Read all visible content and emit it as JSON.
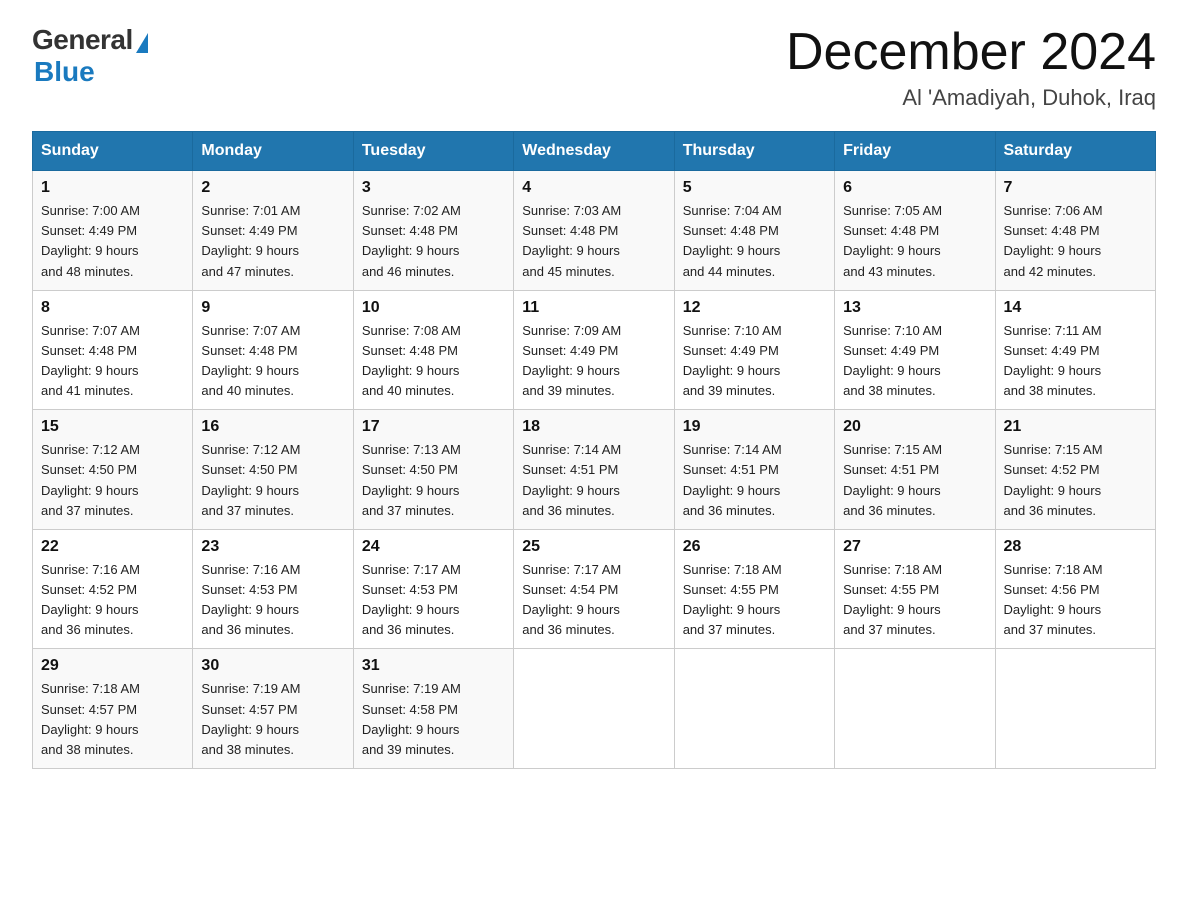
{
  "header": {
    "logo_general": "General",
    "logo_blue": "Blue",
    "month_title": "December 2024",
    "location": "Al 'Amadiyah, Duhok, Iraq"
  },
  "weekdays": [
    "Sunday",
    "Monday",
    "Tuesday",
    "Wednesday",
    "Thursday",
    "Friday",
    "Saturday"
  ],
  "weeks": [
    [
      {
        "day": "1",
        "sunrise": "7:00 AM",
        "sunset": "4:49 PM",
        "daylight": "9 hours and 48 minutes."
      },
      {
        "day": "2",
        "sunrise": "7:01 AM",
        "sunset": "4:49 PM",
        "daylight": "9 hours and 47 minutes."
      },
      {
        "day": "3",
        "sunrise": "7:02 AM",
        "sunset": "4:48 PM",
        "daylight": "9 hours and 46 minutes."
      },
      {
        "day": "4",
        "sunrise": "7:03 AM",
        "sunset": "4:48 PM",
        "daylight": "9 hours and 45 minutes."
      },
      {
        "day": "5",
        "sunrise": "7:04 AM",
        "sunset": "4:48 PM",
        "daylight": "9 hours and 44 minutes."
      },
      {
        "day": "6",
        "sunrise": "7:05 AM",
        "sunset": "4:48 PM",
        "daylight": "9 hours and 43 minutes."
      },
      {
        "day": "7",
        "sunrise": "7:06 AM",
        "sunset": "4:48 PM",
        "daylight": "9 hours and 42 minutes."
      }
    ],
    [
      {
        "day": "8",
        "sunrise": "7:07 AM",
        "sunset": "4:48 PM",
        "daylight": "9 hours and 41 minutes."
      },
      {
        "day": "9",
        "sunrise": "7:07 AM",
        "sunset": "4:48 PM",
        "daylight": "9 hours and 40 minutes."
      },
      {
        "day": "10",
        "sunrise": "7:08 AM",
        "sunset": "4:48 PM",
        "daylight": "9 hours and 40 minutes."
      },
      {
        "day": "11",
        "sunrise": "7:09 AM",
        "sunset": "4:49 PM",
        "daylight": "9 hours and 39 minutes."
      },
      {
        "day": "12",
        "sunrise": "7:10 AM",
        "sunset": "4:49 PM",
        "daylight": "9 hours and 39 minutes."
      },
      {
        "day": "13",
        "sunrise": "7:10 AM",
        "sunset": "4:49 PM",
        "daylight": "9 hours and 38 minutes."
      },
      {
        "day": "14",
        "sunrise": "7:11 AM",
        "sunset": "4:49 PM",
        "daylight": "9 hours and 38 minutes."
      }
    ],
    [
      {
        "day": "15",
        "sunrise": "7:12 AM",
        "sunset": "4:50 PM",
        "daylight": "9 hours and 37 minutes."
      },
      {
        "day": "16",
        "sunrise": "7:12 AM",
        "sunset": "4:50 PM",
        "daylight": "9 hours and 37 minutes."
      },
      {
        "day": "17",
        "sunrise": "7:13 AM",
        "sunset": "4:50 PM",
        "daylight": "9 hours and 37 minutes."
      },
      {
        "day": "18",
        "sunrise": "7:14 AM",
        "sunset": "4:51 PM",
        "daylight": "9 hours and 36 minutes."
      },
      {
        "day": "19",
        "sunrise": "7:14 AM",
        "sunset": "4:51 PM",
        "daylight": "9 hours and 36 minutes."
      },
      {
        "day": "20",
        "sunrise": "7:15 AM",
        "sunset": "4:51 PM",
        "daylight": "9 hours and 36 minutes."
      },
      {
        "day": "21",
        "sunrise": "7:15 AM",
        "sunset": "4:52 PM",
        "daylight": "9 hours and 36 minutes."
      }
    ],
    [
      {
        "day": "22",
        "sunrise": "7:16 AM",
        "sunset": "4:52 PM",
        "daylight": "9 hours and 36 minutes."
      },
      {
        "day": "23",
        "sunrise": "7:16 AM",
        "sunset": "4:53 PM",
        "daylight": "9 hours and 36 minutes."
      },
      {
        "day": "24",
        "sunrise": "7:17 AM",
        "sunset": "4:53 PM",
        "daylight": "9 hours and 36 minutes."
      },
      {
        "day": "25",
        "sunrise": "7:17 AM",
        "sunset": "4:54 PM",
        "daylight": "9 hours and 36 minutes."
      },
      {
        "day": "26",
        "sunrise": "7:18 AM",
        "sunset": "4:55 PM",
        "daylight": "9 hours and 37 minutes."
      },
      {
        "day": "27",
        "sunrise": "7:18 AM",
        "sunset": "4:55 PM",
        "daylight": "9 hours and 37 minutes."
      },
      {
        "day": "28",
        "sunrise": "7:18 AM",
        "sunset": "4:56 PM",
        "daylight": "9 hours and 37 minutes."
      }
    ],
    [
      {
        "day": "29",
        "sunrise": "7:18 AM",
        "sunset": "4:57 PM",
        "daylight": "9 hours and 38 minutes."
      },
      {
        "day": "30",
        "sunrise": "7:19 AM",
        "sunset": "4:57 PM",
        "daylight": "9 hours and 38 minutes."
      },
      {
        "day": "31",
        "sunrise": "7:19 AM",
        "sunset": "4:58 PM",
        "daylight": "9 hours and 39 minutes."
      },
      null,
      null,
      null,
      null
    ]
  ],
  "labels": {
    "sunrise": "Sunrise:",
    "sunset": "Sunset:",
    "daylight": "Daylight:"
  },
  "colors": {
    "header_bg": "#2176ae",
    "header_text": "#ffffff"
  }
}
